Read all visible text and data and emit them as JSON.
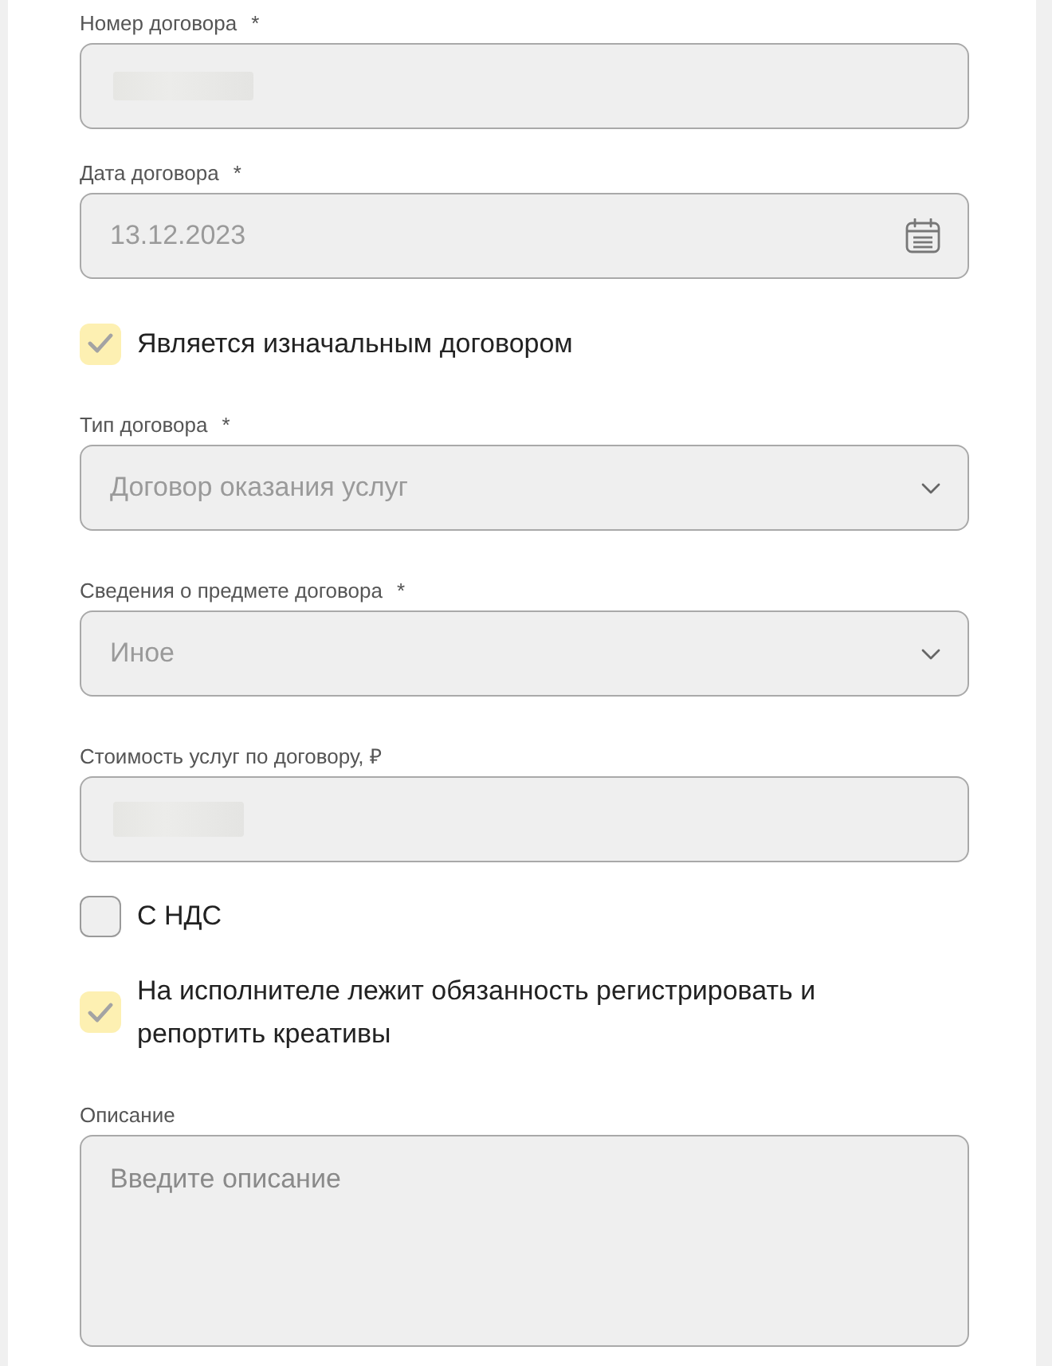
{
  "fields": [
    {
      "kind": "input",
      "label": "Номер договора",
      "required_mark": "*",
      "redacted": true,
      "disabled": true
    },
    {
      "kind": "date",
      "label": "Дата договора",
      "required_mark": "*",
      "value": "13.12.2023",
      "disabled": true
    },
    {
      "kind": "checkbox",
      "label": "Является изначальным договором",
      "checked": true,
      "disabled": true
    },
    {
      "kind": "select",
      "label": "Тип договора",
      "required_mark": "*",
      "value": "Договор оказания услуг",
      "disabled": true
    },
    {
      "kind": "select",
      "label": "Сведения о предмете договора",
      "required_mark": "*",
      "value": "Иное",
      "disabled": true
    },
    {
      "kind": "input",
      "label": "Стоимость услуг по договору, ₽",
      "redacted": true,
      "disabled": true
    },
    {
      "kind": "checkbox",
      "label": "С НДС",
      "checked": false,
      "disabled": true
    },
    {
      "kind": "checkbox",
      "label": "На исполнителе лежит обязанность регистрировать и репортить креативы",
      "checked": true,
      "disabled": true
    },
    {
      "kind": "textarea",
      "label": "Описание",
      "placeholder": "Введите описание",
      "disabled": true
    }
  ]
}
